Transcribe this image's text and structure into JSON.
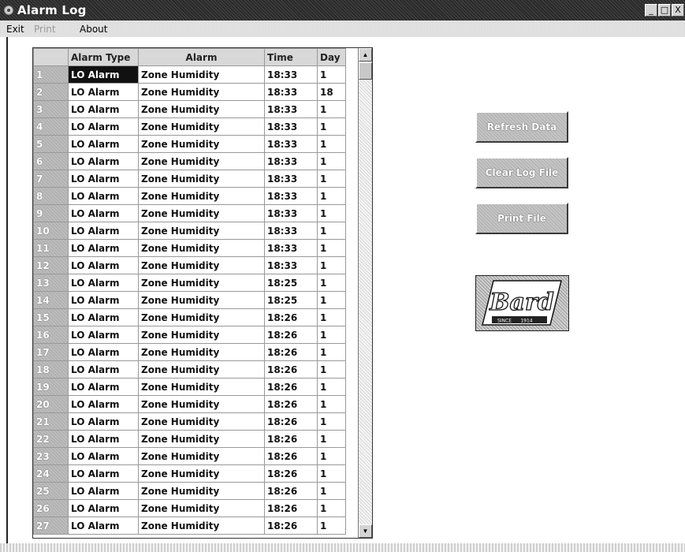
{
  "window": {
    "title": "Alarm Log",
    "controls": [
      "_",
      "□",
      "X"
    ]
  },
  "menu": {
    "items": [
      {
        "label": "Exit",
        "enabled": true
      },
      {
        "label": "Print",
        "enabled": false
      },
      {
        "label": "About",
        "enabled": true
      }
    ]
  },
  "grid": {
    "columns": [
      "Alarm Type",
      "Alarm",
      "Time",
      "Day"
    ],
    "rows": [
      {
        "n": "1",
        "type": "LO Alarm",
        "alarm": "Zone Humidity",
        "time": "18:33",
        "day": "1"
      },
      {
        "n": "2",
        "type": "LO Alarm",
        "alarm": "Zone Humidity",
        "time": "18:33",
        "day": "18"
      },
      {
        "n": "3",
        "type": "LO Alarm",
        "alarm": "Zone Humidity",
        "time": "18:33",
        "day": "1"
      },
      {
        "n": "4",
        "type": "LO Alarm",
        "alarm": "Zone Humidity",
        "time": "18:33",
        "day": "1"
      },
      {
        "n": "5",
        "type": "LO Alarm",
        "alarm": "Zone Humidity",
        "time": "18:33",
        "day": "1"
      },
      {
        "n": "6",
        "type": "LO Alarm",
        "alarm": "Zone Humidity",
        "time": "18:33",
        "day": "1"
      },
      {
        "n": "7",
        "type": "LO Alarm",
        "alarm": "Zone Humidity",
        "time": "18:33",
        "day": "1"
      },
      {
        "n": "8",
        "type": "LO Alarm",
        "alarm": "Zone Humidity",
        "time": "18:33",
        "day": "1"
      },
      {
        "n": "9",
        "type": "LO Alarm",
        "alarm": "Zone Humidity",
        "time": "18:33",
        "day": "1"
      },
      {
        "n": "10",
        "type": "LO Alarm",
        "alarm": "Zone Humidity",
        "time": "18:33",
        "day": "1"
      },
      {
        "n": "11",
        "type": "LO Alarm",
        "alarm": "Zone Humidity",
        "time": "18:33",
        "day": "1"
      },
      {
        "n": "12",
        "type": "LO Alarm",
        "alarm": "Zone Humidity",
        "time": "18:33",
        "day": "1"
      },
      {
        "n": "13",
        "type": "LO Alarm",
        "alarm": "Zone Humidity",
        "time": "18:25",
        "day": "1"
      },
      {
        "n": "14",
        "type": "LO Alarm",
        "alarm": "Zone Humidity",
        "time": "18:25",
        "day": "1"
      },
      {
        "n": "15",
        "type": "LO Alarm",
        "alarm": "Zone Humidity",
        "time": "18:26",
        "day": "1"
      },
      {
        "n": "16",
        "type": "LO Alarm",
        "alarm": "Zone Humidity",
        "time": "18:26",
        "day": "1"
      },
      {
        "n": "17",
        "type": "LO Alarm",
        "alarm": "Zone Humidity",
        "time": "18:26",
        "day": "1"
      },
      {
        "n": "18",
        "type": "LO Alarm",
        "alarm": "Zone Humidity",
        "time": "18:26",
        "day": "1"
      },
      {
        "n": "19",
        "type": "LO Alarm",
        "alarm": "Zone Humidity",
        "time": "18:26",
        "day": "1"
      },
      {
        "n": "20",
        "type": "LO Alarm",
        "alarm": "Zone Humidity",
        "time": "18:26",
        "day": "1"
      },
      {
        "n": "21",
        "type": "LO Alarm",
        "alarm": "Zone Humidity",
        "time": "18:26",
        "day": "1"
      },
      {
        "n": "22",
        "type": "LO Alarm",
        "alarm": "Zone Humidity",
        "time": "18:26",
        "day": "1"
      },
      {
        "n": "23",
        "type": "LO Alarm",
        "alarm": "Zone Humidity",
        "time": "18:26",
        "day": "1"
      },
      {
        "n": "24",
        "type": "LO Alarm",
        "alarm": "Zone Humidity",
        "time": "18:26",
        "day": "1"
      },
      {
        "n": "25",
        "type": "LO Alarm",
        "alarm": "Zone Humidity",
        "time": "18:26",
        "day": "1"
      },
      {
        "n": "26",
        "type": "LO Alarm",
        "alarm": "Zone Humidity",
        "time": "18:26",
        "day": "1"
      },
      {
        "n": "27",
        "type": "LO Alarm",
        "alarm": "Zone Humidity",
        "time": "18:26",
        "day": "1"
      }
    ]
  },
  "buttons": {
    "refresh": "Refresh Data",
    "clear": "Clear Log File",
    "print": "Print File"
  },
  "logo": {
    "name": "Bard",
    "tagline": "SINCE",
    "year": "1914"
  }
}
